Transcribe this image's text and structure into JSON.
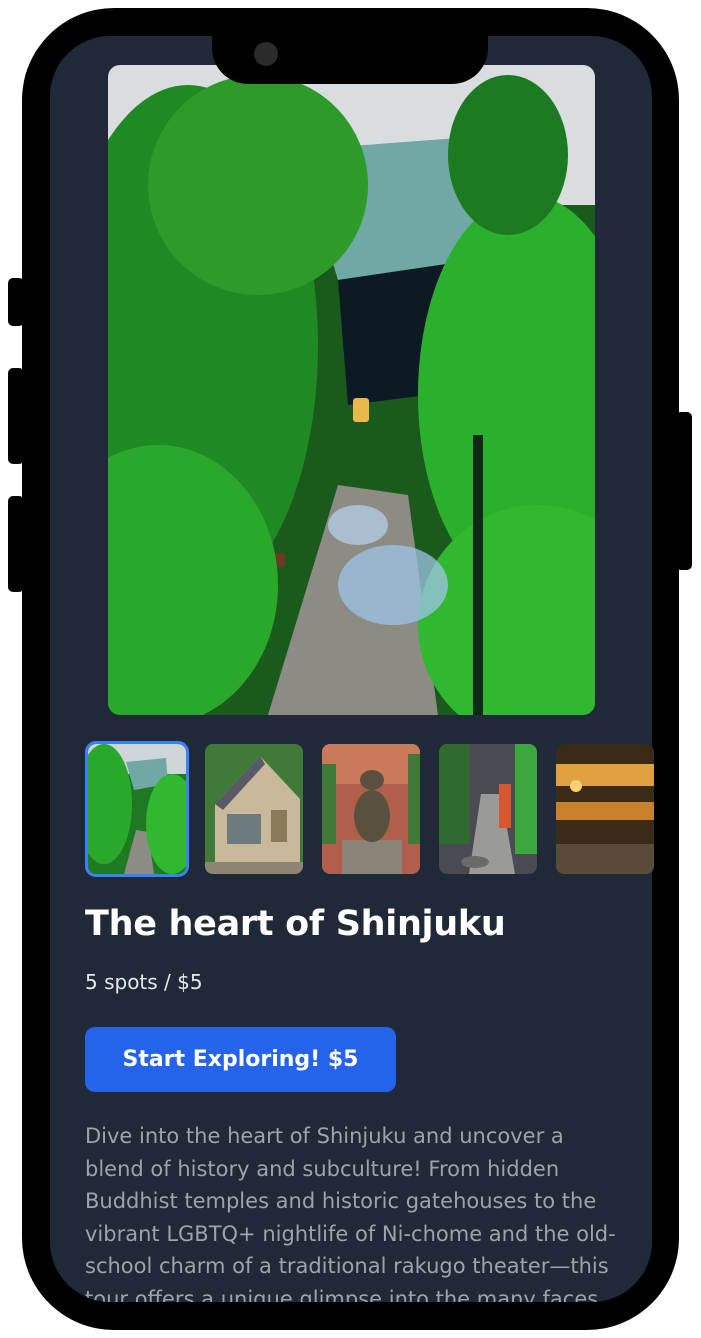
{
  "tour": {
    "title": "The heart of Shinjuku",
    "meta": "5 spots / $5",
    "cta_label": "Start Exploring! $5",
    "description": "Dive into the heart of Shinjuku and uncover a blend of history and subculture! From hidden Buddhist temples and historic gatehouses to the vibrant LGBTQ+ nightlife of Ni-chome and the old-school charm of a traditional rakugo theater—this tour offers a unique glimpse into the many faces of"
  },
  "gallery": {
    "selected_index": 0,
    "count": 5
  },
  "colors": {
    "background": "#1f2937",
    "accent": "#2563eb",
    "selected_outline": "#3b82f6"
  }
}
